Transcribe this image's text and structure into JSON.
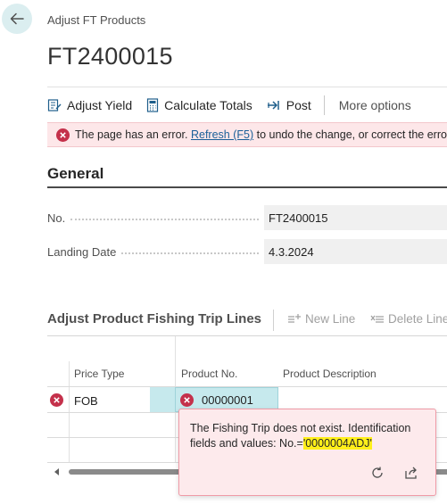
{
  "header": {
    "breadcrumb": "Adjust FT Products",
    "title": "FT2400015"
  },
  "toolbar": {
    "adjust_yield": "Adjust Yield",
    "calculate_totals": "Calculate Totals",
    "post": "Post",
    "more_options": "More options"
  },
  "error_bar": {
    "text_before": "The page has an error.",
    "link": "Refresh (F5)",
    "text_after": "to undo the change, or correct the error."
  },
  "general": {
    "title": "General",
    "no_label": "No.",
    "no_value": "FT2400015",
    "landing_date_label": "Landing Date",
    "landing_date_value": "4.3.2024"
  },
  "lines": {
    "title": "Adjust Product Fishing Trip Lines",
    "new_line": "New Line",
    "delete_line": "Delete Line",
    "columns": {
      "price_type": "Price Type",
      "product_no": "Product No.",
      "product_description": "Product Description"
    },
    "rows": [
      {
        "price_type": "FOB",
        "product_no": "00000001"
      }
    ]
  },
  "popup": {
    "message": "The Fishing Trip does not exist. Identification fields and values: No.=",
    "highlight": "'0000004ADJ'"
  },
  "colors": {
    "error_red": "#c4314b",
    "accent_teal": "#c6e9ed",
    "highlight": "#ffef1a"
  }
}
